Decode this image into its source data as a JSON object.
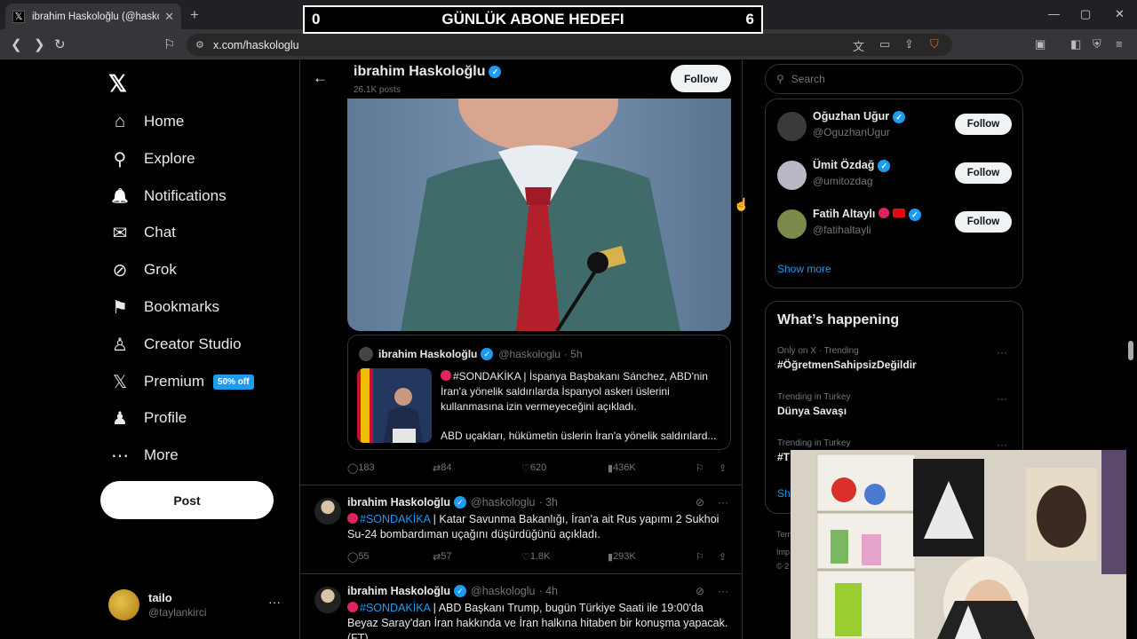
{
  "browser": {
    "tab_title": "ibrahim Haskoloğlu (@haskoloğ",
    "url": "x.com/haskologlu",
    "overlay": {
      "left": "0",
      "center": "GÜNLÜK ABONE HEDEFI",
      "right": "6"
    }
  },
  "nav": {
    "items": [
      {
        "label": "Home",
        "icon": "⌂"
      },
      {
        "label": "Explore",
        "icon": "⚲"
      },
      {
        "label": "Notifications",
        "icon": "🔔"
      },
      {
        "label": "Chat",
        "icon": "✉"
      },
      {
        "label": "Grok",
        "icon": "⊘"
      },
      {
        "label": "Bookmarks",
        "icon": "⚑"
      },
      {
        "label": "Creator Studio",
        "icon": "♙"
      },
      {
        "label": "Premium",
        "icon": "𝕏"
      },
      {
        "label": "Profile",
        "icon": "♟"
      },
      {
        "label": "More",
        "icon": "⋯"
      }
    ],
    "premium_badge": "50% off",
    "post_label": "Post",
    "account": {
      "name": "tailo",
      "handle": "@taylankirci",
      "more": "···"
    }
  },
  "profile": {
    "name": "ibrahim Haskoloğlu",
    "posts": "26.1K posts",
    "follow_label": "Follow"
  },
  "quote": {
    "name": "ibrahim Haskoloğlu",
    "handle": "@haskologlu",
    "time": "· 5h",
    "text1": "#SONDAKİKA | İspanya Başbakanı Sánchez, ABD'nin İran'a yönelik saldırılarda İspanyol askeri üslerini kullanmasına izin vermeyeceğini açıkladı.",
    "text2": "ABD uçakları, hükümetin üslerin İran'a yönelik saldırılard..."
  },
  "tweet0_stats": {
    "replies": "183",
    "reposts": "84",
    "likes": "620",
    "views": "436K"
  },
  "tweets": [
    {
      "name": "ibrahim Haskoloğlu",
      "handle": "@haskologlu",
      "time": "· 3h",
      "tag": "#SONDAKİKA",
      "text": " | Katar Savunma Bakanlığı, İran'a ait Rus yapımı 2 Sukhoi Su-24 bombardıman uçağını düşürdüğünü açıkladı.",
      "replies": "55",
      "reposts": "57",
      "likes": "1.8K",
      "views": "293K"
    },
    {
      "name": "ibrahim Haskoloğlu",
      "handle": "@haskologlu",
      "time": "· 4h",
      "tag": "#SONDAKİKA",
      "text": " | ABD Başkanı Trump, bugün Türkiye Saati ile 19:00'da Beyaz Saray'dan İran hakkında ve İran halkına hitaben bir konuşma yapacak. (FT)"
    }
  ],
  "right": {
    "search_placeholder": "Search",
    "who_to_follow": [
      {
        "name": "Oğuzhan Uğur",
        "handle": "@OguzhanUgur",
        "color": "#3a3a3a"
      },
      {
        "name": "Ümit Özdağ",
        "handle": "@umitozdag",
        "color": "#b9b9c6"
      },
      {
        "name": "Fatih Altaylı",
        "handle": "@fatihaltayli",
        "color": "#7a8a4a"
      }
    ],
    "follow_label": "Follow",
    "show_more": "Show more",
    "happening_title": "What’s happening",
    "trends": [
      {
        "context": "Only on X · Trending",
        "topic": "#ÖğretmenSahipsizDeğildir"
      },
      {
        "context": "Trending in Turkey",
        "topic": "Dünya Savaşı"
      },
      {
        "context": "Trending in Turkey",
        "topic": "#T"
      }
    ],
    "show_partial": "Sho",
    "footer": [
      "Term",
      "Imp",
      "© 2"
    ]
  },
  "colors": {
    "accent": "#1d9bf0",
    "background": "#000000",
    "border": "#2f3336"
  }
}
